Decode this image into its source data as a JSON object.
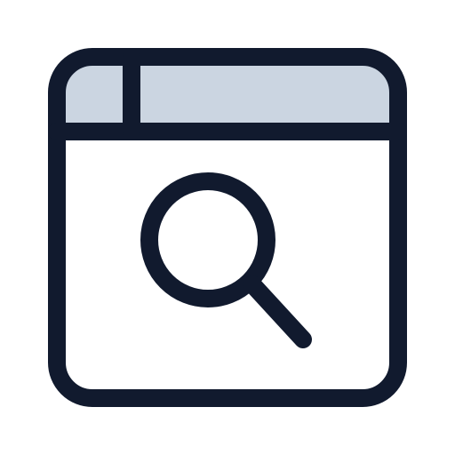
{
  "icon": {
    "name": "browser-window-search-icon",
    "parts": [
      "window-frame",
      "title-bar",
      "tab-divider",
      "magnifying-glass"
    ]
  },
  "colors": {
    "stroke": "#111a2e",
    "title_bar_fill": "#cbd5e1",
    "body_fill": "#ffffff",
    "background": "#ffffff"
  }
}
